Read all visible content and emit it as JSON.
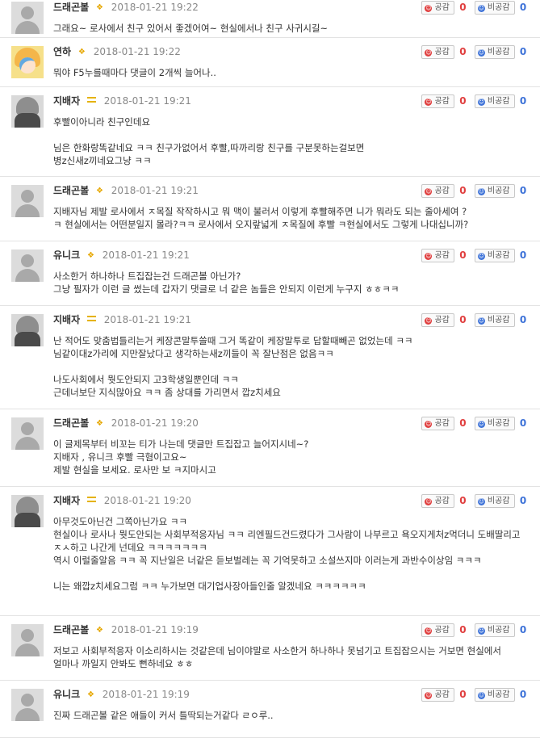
{
  "vote_labels": {
    "like": "공감",
    "dislike": "비공감"
  },
  "comments": [
    {
      "nick": "드래곤볼",
      "badge": "wings",
      "avatar": "default",
      "date": "2018-01-21 19:22",
      "likes": "0",
      "dislikes": "0",
      "text": "그래요~ 로사에서 친구 있어서 좋겠어여~ 현실에서나 친구 사귀시길~"
    },
    {
      "nick": "연하",
      "badge": "wings",
      "avatar": "anime",
      "date": "2018-01-21 19:22",
      "likes": "0",
      "dislikes": "0",
      "text": "뭐야 F5누를때마다 댓글이 2개씩 늘어나.."
    },
    {
      "nick": "지배자",
      "badge": "bar",
      "avatar": "dark",
      "date": "2018-01-21 19:21",
      "likes": "0",
      "dislikes": "0",
      "text": "후빨이아니라 친구인데요\n\n님은 한화랑똑같네요 ㅋㅋ 친구가없어서 후빨,따까리랑 친구를 구분못하는걸보면\n병z신새z끼네요그냥 ㅋㅋ"
    },
    {
      "nick": "드래곤볼",
      "badge": "wings",
      "avatar": "default",
      "date": "2018-01-21 19:21",
      "likes": "0",
      "dislikes": "0",
      "text": "지배자님 제발 로사에서 ㅈ목질 작작하시고 뭐 맥이 불러서 이렇게 후빨해주면 니가 뭐라도 되는 줄아세여 ?\nㅋ 현실에서는 어떤분일지 몰라?ㅋㅋ 로사에서 오지랖넓게 ㅈ목질에 후빨 ㅋ현실에서도 그렇게 나대십니까?"
    },
    {
      "nick": "유니크",
      "badge": "wings",
      "avatar": "default",
      "date": "2018-01-21 19:21",
      "likes": "0",
      "dislikes": "0",
      "text": "사소한거 하나하나 트집잡는건 드래곤볼 아닌가?\n그냥 필자가 이런 글 썼는데 갑자기 댓글로 너 같은 놈들은 안되지 이런게 누구지 ㅎㅎㅋㅋ"
    },
    {
      "nick": "지배자",
      "badge": "bar",
      "avatar": "dark",
      "date": "2018-01-21 19:21",
      "likes": "0",
      "dislikes": "0",
      "text": "난 적어도 맞춤법틀리는거 케장콘말투쓸때 그거 똑같이 케장말투로 답할때빼곤 없었는데 ㅋㅋ\n님같이대z가리에 지만잘났다고 생각하는새z끼들이 꼭 잘난점은 없음ㅋㅋ\n\n나도사회에서 뭣도안되지 고3학생일뿐인데 ㅋㅋ\n근데너보단 지식많아요 ㅋㅋ 좀 상대를 가리면서 깝z치세요"
    },
    {
      "nick": "드래곤볼",
      "badge": "wings",
      "avatar": "default",
      "date": "2018-01-21 19:20",
      "likes": "0",
      "dislikes": "0",
      "text": "이 글제목부터 비꼬는 티가 나는데 댓글만 트집잡고 늘어지시네~?\n지배자 , 유니크 후빨 극혐이고요~\n제발 현실을 보세요. 로사만 보 ㅋ지마시고"
    },
    {
      "nick": "지배자",
      "badge": "bar",
      "avatar": "dark",
      "date": "2018-01-21 19:20",
      "likes": "0",
      "dislikes": "0",
      "text": "아무것도아닌건 그쪽아닌가요 ㅋㅋ\n현실이나 로사나 뭣도안되는 사회부적응자님 ㅋㅋ 리엔필드건드렸다가 그사람이 나부르고 욕오지게처z먹더니 도배딸리고 ㅈㅅ하고 나간게 넌데요 ㅋㅋㅋㅋㅋㅋㅋ\n역시 이럴줄알음 ㅋㅋ 꼭 지난일은 너같은 듣보벌레는 꼭 기억못하고 소설쓰지마 이러는게 과반수이상임 ㅋㅋㅋ\n\n니는 왜깝z치세요그럼 ㅋㅋ 누가보면 대기업사장아들인줄 알겠네요 ㅋㅋㅋㅋㅋㅋ"
    },
    {
      "nick": "드래곤볼",
      "badge": "wings",
      "avatar": "default",
      "date": "2018-01-21 19:19",
      "likes": "0",
      "dislikes": "0",
      "text": "저보고 사회부적응자 이소리하시는 것같은데 님이야말로 사소한거 하나하나 못넘기고 트집잡으시는 거보면 현실에서 얼마나 까일지 안봐도 뻔하네요 ㅎㅎ"
    },
    {
      "nick": "유니크",
      "badge": "wings",
      "avatar": "default",
      "date": "2018-01-21 19:19",
      "likes": "0",
      "dislikes": "0",
      "text": "진짜 드래곤볼 같은 애들이 커서 틀딱되는거같다 ㄹㅇ루.."
    }
  ]
}
